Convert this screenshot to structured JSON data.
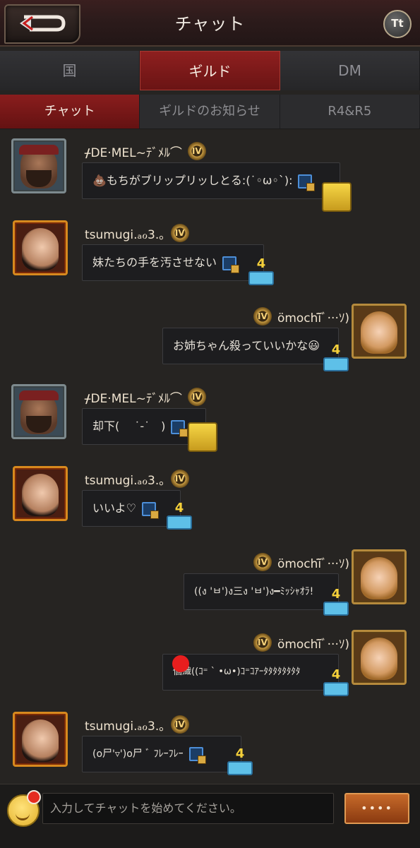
{
  "header": {
    "title": "チャット",
    "font_button": "Tt"
  },
  "main_tabs": [
    {
      "label": "国",
      "active": false
    },
    {
      "label": "ギルド",
      "active": true
    },
    {
      "label": "DM",
      "active": false
    }
  ],
  "sub_tabs": [
    {
      "label": "チャット",
      "active": true
    },
    {
      "label": "ギルドのお知らせ",
      "active": false
    },
    {
      "label": "R4&R5",
      "active": false
    }
  ],
  "messages": [
    {
      "sender": "ᚋDE·MEL~ﾃﾞﾒﾙ⌒",
      "rank": "IV",
      "text": "💩もちがブリップリッしとる:(˙◦ω◦ˋ):",
      "side": "left",
      "badge": "robot"
    },
    {
      "sender": "tsumugi.ₐℴ3.｡",
      "rank": "IV",
      "text": "妹たちの手を汚させない",
      "side": "left",
      "badge": "cake-4"
    },
    {
      "sender": "ömochï̈ﾞ···ｿ)",
      "rank": "IV",
      "text": "お姉ちゃん殺っていいかな😃",
      "side": "right",
      "badge": "cake-4"
    },
    {
      "sender": "ᚋDE·MEL~ﾃﾞﾒﾙ⌒",
      "rank": "IV",
      "text": "却下(　 ˙-˙　)",
      "side": "left",
      "badge": "robot"
    },
    {
      "sender": "tsumugi.ₐℴ3.｡",
      "rank": "IV",
      "text": "いいよ♡",
      "side": "left",
      "badge": "cake-4"
    },
    {
      "sender": "ömochï̈ﾞ···ｿ)",
      "rank": "IV",
      "text": "((ง 'ㅂ')ง三ง 'ㅂ')ง━ﾐｯｼｬｵﾗ!",
      "side": "right",
      "badge": "cake-4"
    },
    {
      "sender": "ömochï̈ﾞ···ｿ)",
      "rank": "IV",
      "text": "個織((ｺ⁼ ˋ •ω•)ｺ⁼ｺｱｰﾀﾀﾀﾀﾀﾀﾀﾀ",
      "side": "right",
      "badge": "cake-4"
    },
    {
      "sender": "tsumugi.ₐℴ3.｡",
      "rank": "IV",
      "text": "(o尸'▿')o尸 ﾞ ﾌﾚｰﾌﾚｰ",
      "side": "left",
      "badge": "cake-4"
    }
  ],
  "cake_number": "4",
  "input": {
    "placeholder": "入力してチャットを始めてください。",
    "send_label": "••••"
  },
  "colors": {
    "accent_red": "#8a1d1d",
    "gold": "#c79b43",
    "bubble": "#1d1d1f"
  }
}
